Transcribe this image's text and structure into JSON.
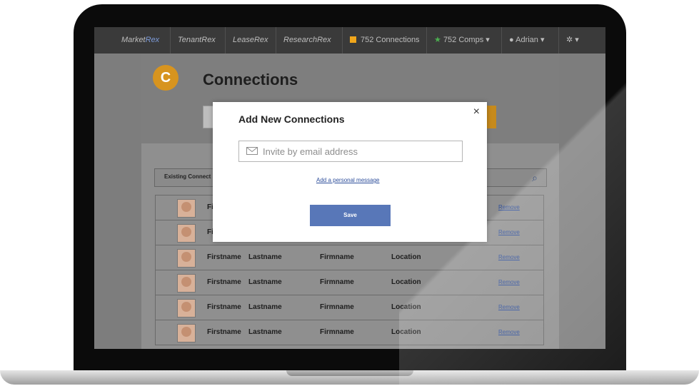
{
  "nav": {
    "brands": [
      {
        "a": "Market",
        "b": "Rex"
      },
      {
        "a": "Tenant",
        "b": "Rex"
      },
      {
        "a": "Lease",
        "b": "Rex"
      },
      {
        "a": "Research",
        "b": "Rex"
      }
    ],
    "connections": "752 Connections",
    "comps": "752 Comps",
    "user": "Adrian"
  },
  "page": {
    "logo_letter": "C",
    "title": "Connections",
    "filter_label": "Existing Connect"
  },
  "rows": [
    {
      "first": "Fi",
      "last": "",
      "firm": "",
      "loc": "",
      "remove": "Remove"
    },
    {
      "first": "Fi",
      "last": "",
      "firm": "",
      "loc": "",
      "remove": "Remove"
    },
    {
      "first": "Firstname",
      "last": "Lastname",
      "firm": "Firmname",
      "loc": "Location",
      "remove": "Remove"
    },
    {
      "first": "Firstname",
      "last": "Lastname",
      "firm": "Firmname",
      "loc": "Location",
      "remove": "Remove"
    },
    {
      "first": "Firstname",
      "last": "Lastname",
      "firm": "Firmname",
      "loc": "Location",
      "remove": "Remove"
    },
    {
      "first": "Firstname",
      "last": "Lastname",
      "firm": "Firmname",
      "loc": "Location",
      "remove": "Remove"
    }
  ],
  "modal": {
    "title": "Add New Connections",
    "close": "×",
    "email_placeholder": "Invite by email address",
    "message_link": "Add a personal message",
    "save": "Save"
  }
}
